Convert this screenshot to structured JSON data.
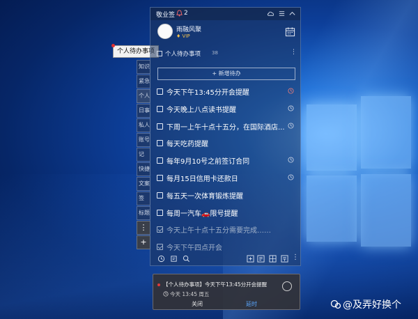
{
  "colors": {
    "accent": "#5aa7ff",
    "badge": "#e03a3a",
    "vip": "#f2c14e"
  },
  "tooltip": {
    "label": "个人待办事项"
  },
  "sidetabs": [
    {
      "label": "知识"
    },
    {
      "label": "紧急"
    },
    {
      "label": "个人"
    },
    {
      "label": "日事"
    },
    {
      "label": "私人"
    },
    {
      "label": "账号"
    },
    {
      "label": "记"
    },
    {
      "label": "快捷"
    },
    {
      "label": "文案"
    },
    {
      "label": "签"
    },
    {
      "label": "标题"
    }
  ],
  "sidetab_buttons": {
    "more": "⋮",
    "add": "+"
  },
  "header": {
    "app_title": "敬业签",
    "bell_count": "2"
  },
  "user": {
    "name": "雨融风聚",
    "badge": "VIP"
  },
  "list": {
    "title": "个人待办事项",
    "count": "38",
    "more": "⋮",
    "add_label": "+ 新增待办"
  },
  "tasks": [
    {
      "text": "今天下午13:45分开会提醒",
      "done": false,
      "has_reminder": true
    },
    {
      "text": "今天晚上八点读书提醒",
      "done": false,
      "has_reminder": true
    },
    {
      "text": "下周一上午十点十五分，在国际酒店...",
      "done": false,
      "has_reminder": true
    },
    {
      "text": "每天吃药提醒",
      "done": false,
      "has_reminder": false
    },
    {
      "text": "每年9月10号之前签订合同",
      "done": false,
      "has_reminder": true
    },
    {
      "text": "每月15日信用卡还款日",
      "done": false,
      "has_reminder": true
    },
    {
      "text": "每五天一次体育锻炼提醒",
      "done": false,
      "has_reminder": false
    },
    {
      "text": "每周一汽车🚗限号提醒",
      "done": false,
      "has_reminder": false
    },
    {
      "text": "今天上午十点十五分需要完成……",
      "done": true,
      "has_reminder": false
    },
    {
      "text": "今天下午四点开会",
      "done": true,
      "has_reminder": false
    }
  ],
  "notification": {
    "text": "【个人待办事项】今天下午13:45分开会提醒",
    "time": "今天 13:45 周五",
    "close_label": "关闭",
    "snooze_label": "延时"
  },
  "watermark": "@及弄好换个"
}
